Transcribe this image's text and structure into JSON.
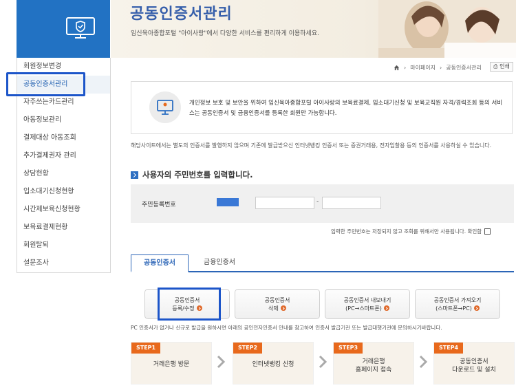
{
  "hero": {
    "title": "공동인증서관리",
    "subtitle": "임신육아종합포털 \"아이사랑\"에서 다양한 서비스를 편리하게 이용하세요."
  },
  "sidebar": {
    "items": [
      {
        "label": "회원정보변경"
      },
      {
        "label": "공동인증서관리"
      },
      {
        "label": "자주쓰는카드관리"
      },
      {
        "label": "아동정보관리"
      },
      {
        "label": "결제대상 아동조회"
      },
      {
        "label": "추가결제권자 관리"
      },
      {
        "label": "상담현황"
      },
      {
        "label": "입소대기신청현황"
      },
      {
        "label": "시간제보육신청현황"
      },
      {
        "label": "보육료결제현황"
      },
      {
        "label": "회원탈퇴"
      },
      {
        "label": "설문조사"
      }
    ],
    "active_index": 1
  },
  "breadcrumb": {
    "home_icon": "home-icon",
    "items": [
      "마이페이지",
      "공동인증서관리"
    ],
    "print_label": "인쇄"
  },
  "notice": {
    "text": "개인정보 보호 및 보안을 위하여 임신육아종합포털 아이사랑의 보육료결제, 입소대기신청 및 보육교직원 자격/경력조회 등의 서비스는 공동인증서 및 금융인증서를 등록한 회원만 가능합니다."
  },
  "description": "해당사이트에서는 별도의 인증서를 발행하지 않으며 기존에 발급받으신 인터넷뱅킹 인증서 또는 증권거래용, 전자입찰용 등의 인증서를 사용하실 수 있습니다.",
  "rrn": {
    "section_title": "사용자의 주민번호를 입력합니다.",
    "label": "주민등록번호",
    "dash": "-",
    "confirm_text": "입력한 주민번호는 저장되지 않고 조회를 위해서만 사용됩니다. 확인함"
  },
  "tabs": [
    {
      "label": "공동인증서"
    },
    {
      "label": "금융인증서"
    }
  ],
  "actions": [
    {
      "line1": "공동인증서",
      "line2": "등록/수정"
    },
    {
      "line1": "공동인증서",
      "line2": "삭제"
    },
    {
      "line1": "공동인증서 내보내기",
      "line2": "(PC→스마트폰)"
    },
    {
      "line1": "공동인증서 가져오기",
      "line2": "(스마트폰→PC)"
    }
  ],
  "pc_note": "PC 인증서가 없거나 신규로 발급을 원하시면 아래의 공인전자인증서 안내를 참고하여 인증서 발급기관 또는 발급대행기관에 문의하시기바랍니다.",
  "steps": [
    {
      "badge": "STEP1",
      "line1": "거래은행 방문",
      "line2": ""
    },
    {
      "badge": "STEP2",
      "line1": "인터넷뱅킹 신청",
      "line2": ""
    },
    {
      "badge": "STEP3",
      "line1": "거래은행",
      "line2": "홈페이지 접속"
    },
    {
      "badge": "STEP4",
      "line1": "공동인증서",
      "line2": "다운로드 및 설치"
    }
  ],
  "colors": {
    "brand_blue": "#2272c3",
    "title_blue": "#355eaa",
    "step_orange": "#e8691c",
    "highlight": "#1c55c9"
  }
}
